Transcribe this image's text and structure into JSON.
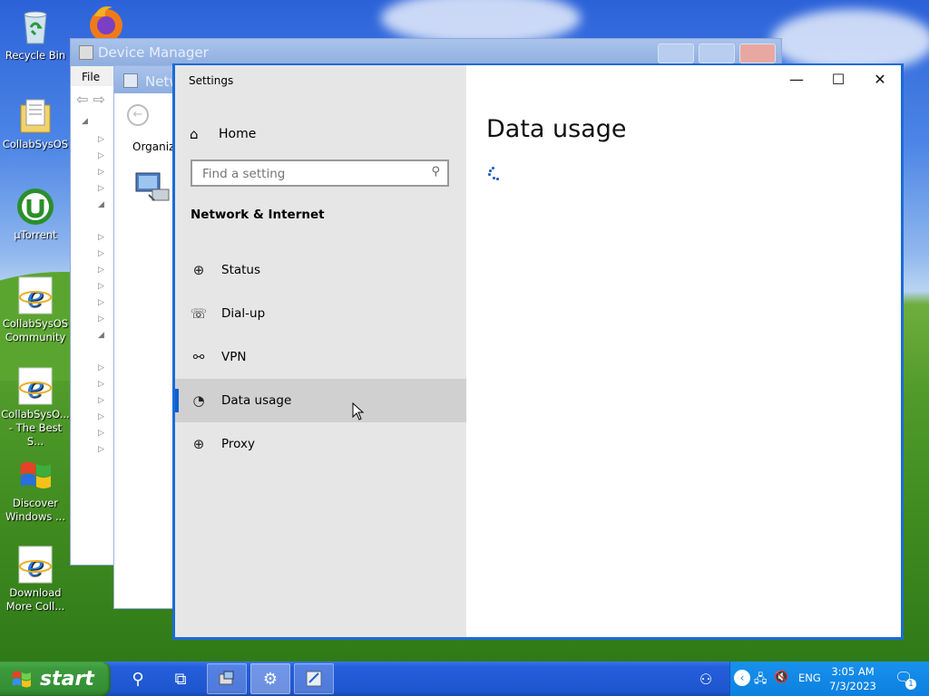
{
  "desktop": {
    "icons": [
      {
        "label": "Recycle Bin",
        "icon": "recycle-bin-icon"
      },
      {
        "label": "CollabSysOS",
        "icon": "folder-document-icon"
      },
      {
        "label": "µTorrent",
        "icon": "utorrent-icon"
      },
      {
        "label": "CollabSysOS Community",
        "icon": "internet-explorer-icon"
      },
      {
        "label": "CollabSysO... - The Best S...",
        "icon": "internet-explorer-icon"
      },
      {
        "label": "Discover Windows ...",
        "icon": "windows-flag-icon"
      },
      {
        "label": "Download More Coll...",
        "icon": "internet-explorer-icon"
      }
    ]
  },
  "device_manager": {
    "title": "Device Manager",
    "menu": [
      "File"
    ]
  },
  "network_window": {
    "title": "Netw",
    "toolbar_label": "Organiz"
  },
  "settings": {
    "app_title": "Settings",
    "home_label": "Home",
    "search_placeholder": "Find a setting",
    "section_title": "Network & Internet",
    "nav_items": [
      {
        "label": "Status",
        "icon": "status-globe-icon"
      },
      {
        "label": "Dial-up",
        "icon": "dialup-icon"
      },
      {
        "label": "VPN",
        "icon": "vpn-icon"
      },
      {
        "label": "Data usage",
        "icon": "data-usage-icon",
        "selected": true
      },
      {
        "label": "Proxy",
        "icon": "proxy-globe-icon"
      }
    ],
    "page_title": "Data usage",
    "window_controls": {
      "minimize": "—",
      "maximize": "☐",
      "close": "✕"
    }
  },
  "taskbar": {
    "start_label": "start",
    "tray": {
      "language": "ENG",
      "time": "3:05 AM",
      "date": "7/3/2023",
      "notification_count": "1"
    }
  },
  "colors": {
    "accent": "#0d5fd1",
    "window_border": "#1c6bd6",
    "nav_background": "#e6e6e6",
    "nav_selected": "#d0d0d0",
    "taskbar": "#245edb",
    "start_green": "#3d9a3d"
  }
}
